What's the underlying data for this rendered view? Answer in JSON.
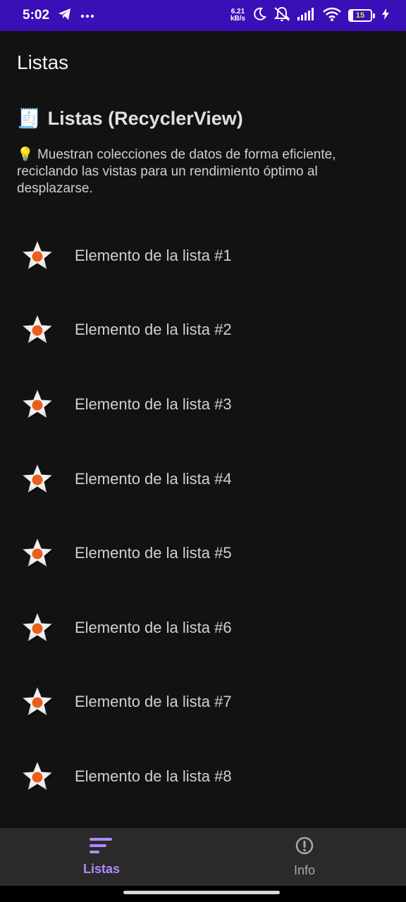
{
  "status_bar": {
    "time": "5:02",
    "speed_value": "6.21",
    "speed_unit": "kB/s",
    "battery": "15",
    "battery_level": 0.15
  },
  "app_bar": {
    "title": "Listas"
  },
  "section": {
    "emoji": "🧾",
    "title": "Listas (RecyclerView)",
    "description_emoji": "💡",
    "description": "Muestran colecciones de datos de forma eficiente, reciclando las vistas para un rendimiento óptimo al desplazarse."
  },
  "list": {
    "items": [
      {
        "label": "Elemento de la lista #1"
      },
      {
        "label": "Elemento de la lista #2"
      },
      {
        "label": "Elemento de la lista #3"
      },
      {
        "label": "Elemento de la lista #4"
      },
      {
        "label": "Elemento de la lista #5"
      },
      {
        "label": "Elemento de la lista #6"
      },
      {
        "label": "Elemento de la lista #7"
      },
      {
        "label": "Elemento de la lista #8"
      }
    ],
    "icon": "star-icon"
  },
  "bottom_nav": {
    "items": [
      {
        "label": "Listas",
        "icon": "list-icon",
        "active": true
      },
      {
        "label": "Info",
        "icon": "info-icon",
        "active": false
      }
    ],
    "accent": "#b388ff"
  },
  "colors": {
    "status_bar": "#3a0fb8",
    "background": "#121212",
    "nav_background": "#2a2a2a",
    "star_outer": "#ffffff",
    "star_center": "#e8601c"
  }
}
